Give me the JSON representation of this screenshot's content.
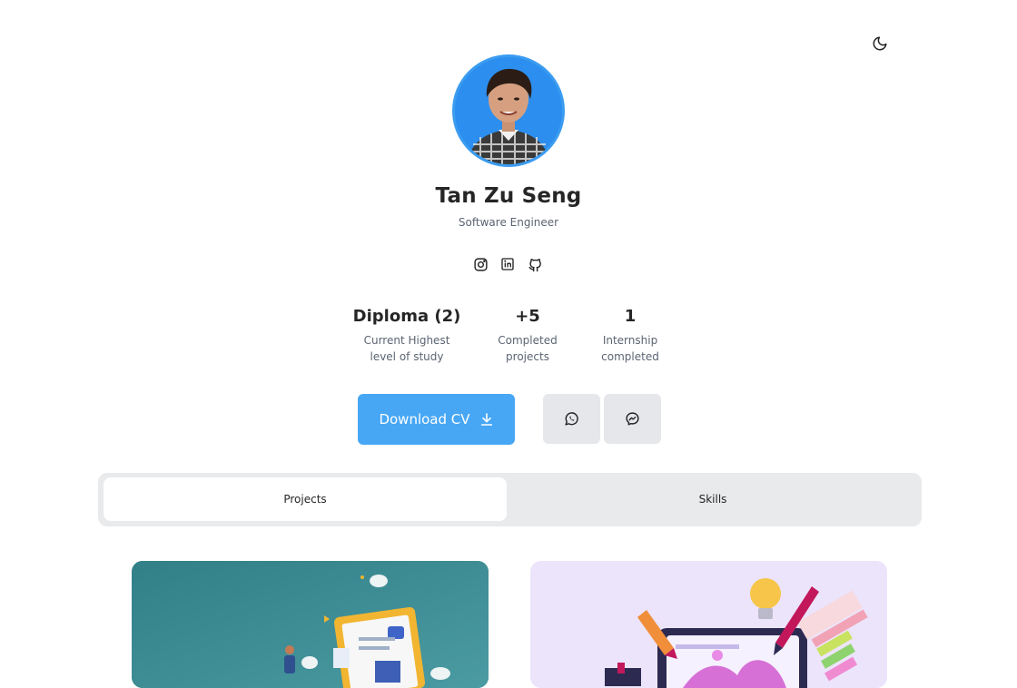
{
  "profile": {
    "name": "Tan Zu Seng",
    "role": "Software Engineer"
  },
  "icons": {
    "theme": "moon-icon",
    "socials": [
      "instagram-icon",
      "linkedin-icon",
      "github-icon"
    ]
  },
  "stats": [
    {
      "value": "Diploma (2)",
      "label_line1": "Current Highest",
      "label_line2": "level of study"
    },
    {
      "value": "+5",
      "label_line1": "Completed",
      "label_line2": "projects"
    },
    {
      "value": "1",
      "label_line1": "Internship",
      "label_line2": "completed"
    }
  ],
  "actions": {
    "download_cv": "Download CV",
    "contact_icons": [
      "whatsapp-icon",
      "messenger-icon"
    ]
  },
  "tabs": [
    {
      "label": "Projects",
      "active": true
    },
    {
      "label": "Skills",
      "active": false
    }
  ],
  "colors": {
    "accent": "#47a7f5",
    "card1_bg": "#3f8f97",
    "card2_bg": "#ece4fb"
  }
}
